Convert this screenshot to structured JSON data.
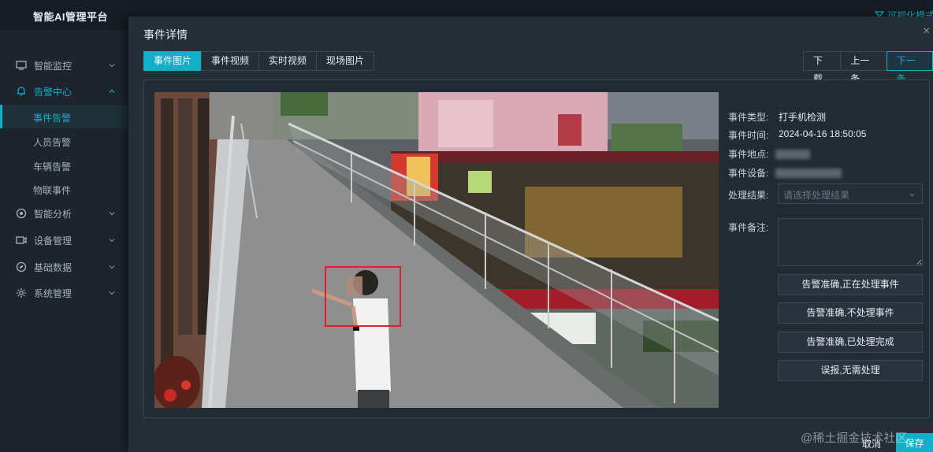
{
  "app": {
    "brand": "智能AI管理平台",
    "top_right_link": "可视化模式"
  },
  "sidebar": {
    "items": [
      {
        "label": "智能监控",
        "icon": "monitor-icon",
        "expanded": false
      },
      {
        "label": "告警中心",
        "icon": "bell-icon",
        "expanded": true,
        "children": [
          {
            "label": "事件告警",
            "active": true
          },
          {
            "label": "人员告警",
            "active": false
          },
          {
            "label": "车辆告警",
            "active": false
          },
          {
            "label": "物联事件",
            "active": false
          }
        ]
      },
      {
        "label": "智能分析",
        "icon": "target-icon",
        "expanded": false
      },
      {
        "label": "设备管理",
        "icon": "camera-icon",
        "expanded": false
      },
      {
        "label": "基础数据",
        "icon": "compass-icon",
        "expanded": false
      },
      {
        "label": "系统管理",
        "icon": "gear-icon",
        "expanded": false
      }
    ]
  },
  "modal": {
    "title": "事件详情",
    "close": "×",
    "tabs": [
      {
        "label": "事件图片",
        "active": true
      },
      {
        "label": "事件视频",
        "active": false
      },
      {
        "label": "实时视频",
        "active": false
      },
      {
        "label": "现场图片",
        "active": false
      }
    ],
    "nav": {
      "download": "下载",
      "prev": "上一条",
      "next": "下一条"
    },
    "details": {
      "type_label": "事件类型:",
      "type_value": "打手机检测",
      "time_label": "事件时间:",
      "time_value": "2024-04-16 18:50:05",
      "location_label": "事件地点:",
      "device_label": "事件设备:",
      "result_label": "处理结果:",
      "result_placeholder": "请选择处理结果",
      "notes_label": "事件备注:"
    },
    "actions": [
      "告警准确,正在处理事件",
      "告警准确,不处理事件",
      "告警准确,已处理完成",
      "误报,无需处理"
    ],
    "footer": {
      "cancel": "取消",
      "save": "保存"
    }
  },
  "watermark": "@稀土掘金技术社区",
  "colors": {
    "accent": "#12b0c8",
    "detection_box": "#e0202a",
    "background": "#1b222b"
  }
}
